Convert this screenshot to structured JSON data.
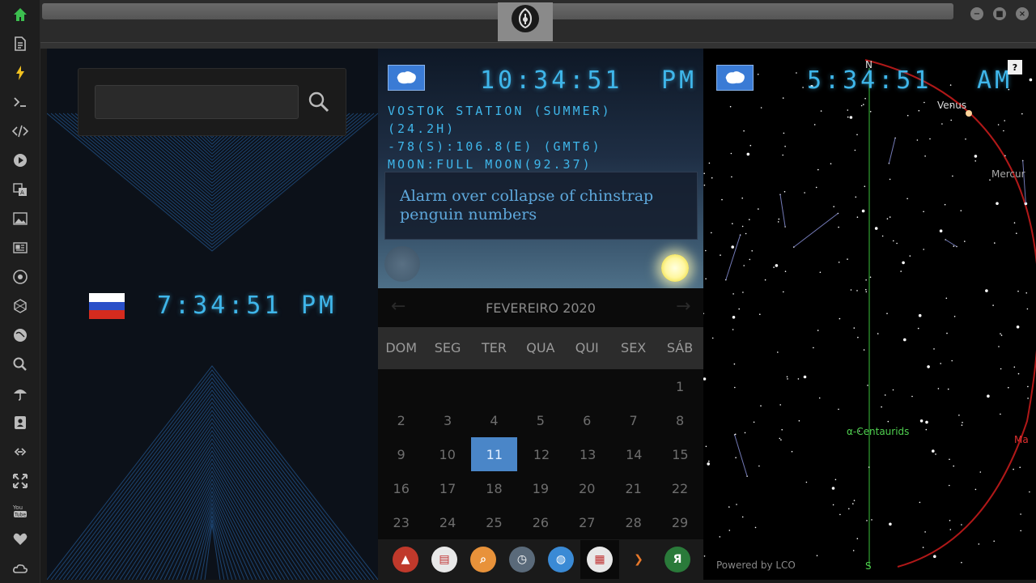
{
  "sidebar": {
    "icons": [
      "home-icon",
      "document-icon",
      "bolt-icon",
      "terminal-icon",
      "code-icon",
      "play-icon",
      "translate-icon",
      "image-icon",
      "news-icon",
      "rebel-icon",
      "hexagon-icon",
      "globe-icon",
      "search-icon",
      "umbrella-icon",
      "contacts-icon",
      "link-icon",
      "expand-icon",
      "youtube-icon",
      "heart-icon",
      "cloud-icon"
    ]
  },
  "window": {
    "min": "−",
    "max": "■",
    "close": "×"
  },
  "left_clock": {
    "search_placeholder": "",
    "time": "7:34:51",
    "ampm": "PM"
  },
  "mid_clock": {
    "time": "10:34:51",
    "ampm": "PM",
    "line1": "VOSTOK STATION (SUMMER)",
    "line2": "(24.2H)",
    "line3": "-78(S):106.8(E) (GMT6)",
    "line4": "MOON:FULL MOON(92.37)",
    "news": "Alarm over collapse of chinstrap penguin numbers"
  },
  "calendar": {
    "prev": "←",
    "next": "→",
    "month": "FEVEREIRO 2020",
    "weekdays": [
      "DOM",
      "SEG",
      "TER",
      "QUA",
      "QUI",
      "SEX",
      "SÁB"
    ],
    "weeks": [
      [
        "",
        "",
        "",
        "",
        "",
        "",
        "1"
      ],
      [
        "2",
        "3",
        "4",
        "5",
        "6",
        "7",
        "8"
      ],
      [
        "9",
        "10",
        "11",
        "12",
        "13",
        "14",
        "15"
      ],
      [
        "16",
        "17",
        "18",
        "19",
        "20",
        "21",
        "22"
      ],
      [
        "23",
        "24",
        "25",
        "26",
        "27",
        "28",
        "29"
      ]
    ],
    "today": "11"
  },
  "dock": {
    "items": [
      {
        "name": "dock-app-red",
        "color": "#c0392b",
        "glyph": "▲"
      },
      {
        "name": "dock-app-news",
        "color": "#e8e8e8",
        "glyph": "▤"
      },
      {
        "name": "dock-app-search",
        "color": "#e8923a",
        "glyph": "⌕"
      },
      {
        "name": "dock-app-clock",
        "color": "#5a6a7a",
        "glyph": "◷"
      },
      {
        "name": "dock-app-globe",
        "color": "#3a8ad5",
        "glyph": "◍"
      },
      {
        "name": "dock-app-calendar",
        "color": "#e8e8e8",
        "glyph": "▦"
      },
      {
        "name": "dock-app-play",
        "color": "#1a1a1a",
        "glyph": "❯"
      },
      {
        "name": "dock-app-yandex",
        "color": "#2a7a3a",
        "glyph": "Я"
      }
    ]
  },
  "sky": {
    "time": "5:34:51",
    "ampm": "AM",
    "help": "?",
    "north": "N",
    "south": "S",
    "venus": "Venus",
    "mercury": "Mercur",
    "mars": "Ma",
    "meteor": "α-Centaurids",
    "powered": "Powered by LCO"
  },
  "colors": {
    "accent": "#3fb6ea",
    "today": "#4a86c8",
    "sky_label": "#dddddd",
    "meteor": "#4fd04f",
    "planet_red": "#e03030"
  }
}
